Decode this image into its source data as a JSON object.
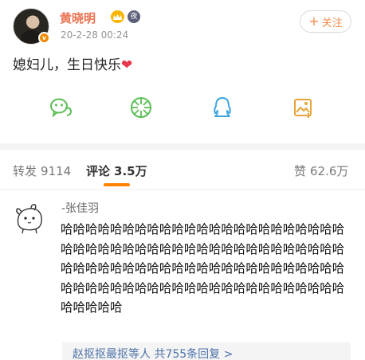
{
  "post": {
    "username": "黄晓明",
    "timestamp": "20-2-28 00:24",
    "night_badge": "夜",
    "follow_label": "关注",
    "follow_plus": "+",
    "text": "媳妇儿，生日快乐",
    "share_icons": [
      "wechat-icon",
      "moments-icon",
      "qq-icon",
      "qzone-image-icon"
    ]
  },
  "tabs": [
    {
      "label": "转发",
      "count": "9114"
    },
    {
      "label": "评论",
      "count": "3.5万"
    },
    {
      "label": "赞",
      "count": "62.6万"
    }
  ],
  "comment": {
    "user": "-张佳羽",
    "text": "哈哈哈哈哈哈哈哈哈哈哈哈哈哈哈哈哈哈哈哈哈哈哈哈哈哈哈哈哈哈哈哈哈哈哈哈哈哈哈哈哈哈哈哈哈哈哈哈哈哈哈哈哈哈哈哈哈哈哈哈哈哈哈哈哈哈哈哈哈哈哈哈哈哈哈哈哈哈哈哈哈哈哈哈哈哈哈哈哈哈哈哈哈哈哈哈哈",
    "replies_label": "赵抠抠最抠等人 共755条回复 >"
  },
  "colors": {
    "username": "#eb7350",
    "accent": "#ff8200",
    "link": "#4d72a8",
    "heart": "#e8384b"
  }
}
